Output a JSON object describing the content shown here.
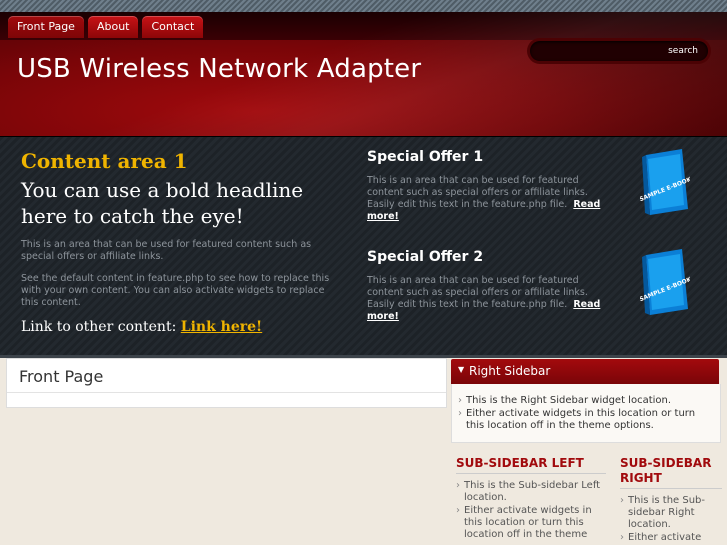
{
  "nav": {
    "tabs": [
      {
        "label": "Front Page"
      },
      {
        "label": "About"
      },
      {
        "label": "Contact"
      }
    ]
  },
  "search": {
    "button_label": "search",
    "value": ""
  },
  "site": {
    "title": "USB Wireless Network Adapter"
  },
  "feature": {
    "heading": "Content area 1",
    "headline": "You can use a bold headline here to catch the eye!",
    "text1": "This is an area that can be used for featured content such as special offers or affiliate links.",
    "text2": "See the default content in feature.php to see how to replace this with your own content. You can also activate widgets to replace this content.",
    "link_prefix": "Link to other content: ",
    "link_text": "Link here!",
    "offers": [
      {
        "title": "Special Offer 1",
        "text": "This is an area that can be used for featured content such as special offers or affiliate links. Easily edit this text in the feature.php file.",
        "link": "Read more!",
        "book_label": "SAMPLE E-BOOK"
      },
      {
        "title": "Special Offer 2",
        "text": "This is an area that can be used for featured content such as special offers or affiliate links. Easily edit this text in the feature.php file.",
        "link": "Read more!",
        "book_label": "SAMPLE E-BOOK"
      }
    ]
  },
  "main": {
    "page_title": "Front Page"
  },
  "sidebar": {
    "title": "Right Sidebar",
    "items": [
      "This is the Right Sidebar widget location.",
      "Either activate widgets in this location or turn this location off in the theme options."
    ]
  },
  "sub_left": {
    "title": "SUB-SIDEBAR LEFT",
    "items": [
      "This is the Sub-sidebar Left location.",
      "Either activate widgets in this location or turn this location off in the theme"
    ]
  },
  "sub_right": {
    "title": "SUB-SIDEBAR RIGHT",
    "items": [
      "This is the Sub-sidebar Right location.",
      "Either activate"
    ]
  },
  "colors": {
    "brand_red": "#a10a0d",
    "accent_gold": "#f0b400"
  }
}
